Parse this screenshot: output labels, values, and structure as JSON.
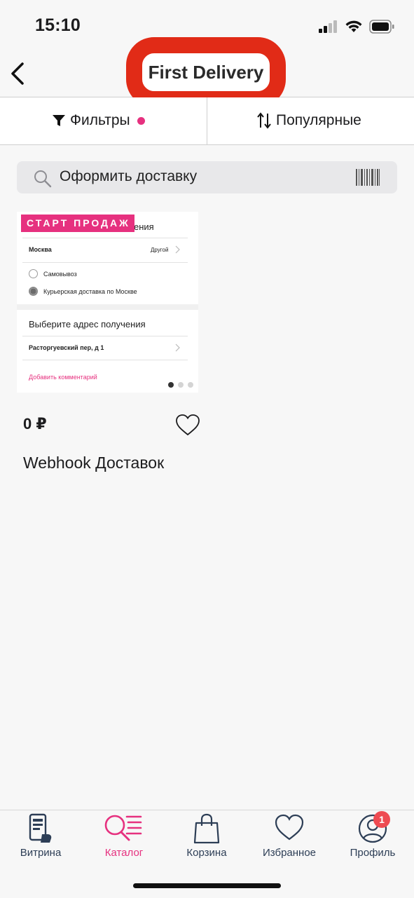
{
  "status_bar": {
    "time": "15:10"
  },
  "header": {
    "title": "First Delivery"
  },
  "toolbar": {
    "filters_label": "Фильтры",
    "sort_label": "Популярные"
  },
  "search": {
    "text": "Оформить доставку"
  },
  "product": {
    "badge": "СТАРТ ПРОДАЖ",
    "price": "0 ₽",
    "name": "Webhook Доставок",
    "preview": {
      "heading_partial": "ения",
      "city": "Москва",
      "city_change": "Другой",
      "option_pickup": "Самовывоз",
      "option_courier": "Курьерская доставка по Москве",
      "address_heading": "Выберите адрес получения",
      "address": "Расторгуевский пер, д 1",
      "add_comment": "Добавить комментарий"
    },
    "image_count": 3,
    "active_image_index": 0
  },
  "tabs": [
    {
      "label": "Витрина",
      "icon": "phone-hand-icon",
      "active": false
    },
    {
      "label": "Каталог",
      "icon": "catalog-search-icon",
      "active": true
    },
    {
      "label": "Корзина",
      "icon": "shopping-bag-icon",
      "active": false
    },
    {
      "label": "Избранное",
      "icon": "heart-icon",
      "active": false
    },
    {
      "label": "Профиль",
      "icon": "profile-icon",
      "active": false,
      "badge": "1"
    }
  ],
  "colors": {
    "accent": "#e6317f",
    "highlight": "#e12b17",
    "tab_inactive": "#2d3e56"
  }
}
